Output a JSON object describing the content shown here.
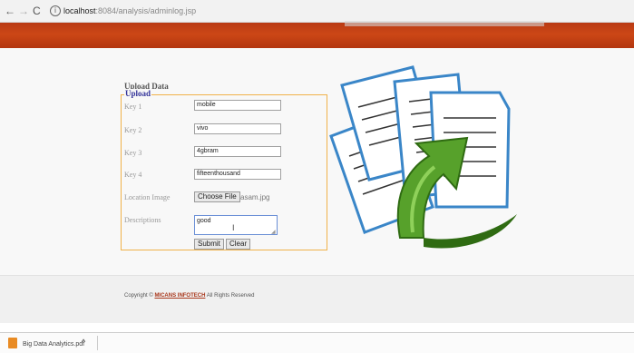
{
  "browser": {
    "url_host": "localhost",
    "url_rest": ":8084/analysis/adminlog.jsp"
  },
  "form": {
    "section_title": "Upload Data",
    "legend": "Upload",
    "fields": [
      {
        "label": "Key 1",
        "value": "mobile"
      },
      {
        "label": "Key 2",
        "value": "vivo"
      },
      {
        "label": "Key 3",
        "value": "4gbram"
      },
      {
        "label": "Key 4",
        "value": "fifteenthousand"
      }
    ],
    "location_label": "Location Image",
    "choose_file_label": "Choose File",
    "file_name": "asam.jpg",
    "descriptions_label": "Descriptions",
    "descriptions_value": "good",
    "submit_label": "Submit",
    "clear_label": "Clear"
  },
  "footer": {
    "prefix": "Copyright © ",
    "company": "MICANS INFOTECH",
    "suffix": " All Rights Reserved"
  },
  "downloads": {
    "file": "Big Data Analytics.pdf"
  },
  "icons": {
    "illustration": "document-upload-arrow",
    "download_file": "pdf-file-icon"
  },
  "colors": {
    "banner": "#c2410f",
    "legend": "#333399",
    "fieldset_border": "#f0b24a",
    "arrow": "#4d8a22"
  }
}
